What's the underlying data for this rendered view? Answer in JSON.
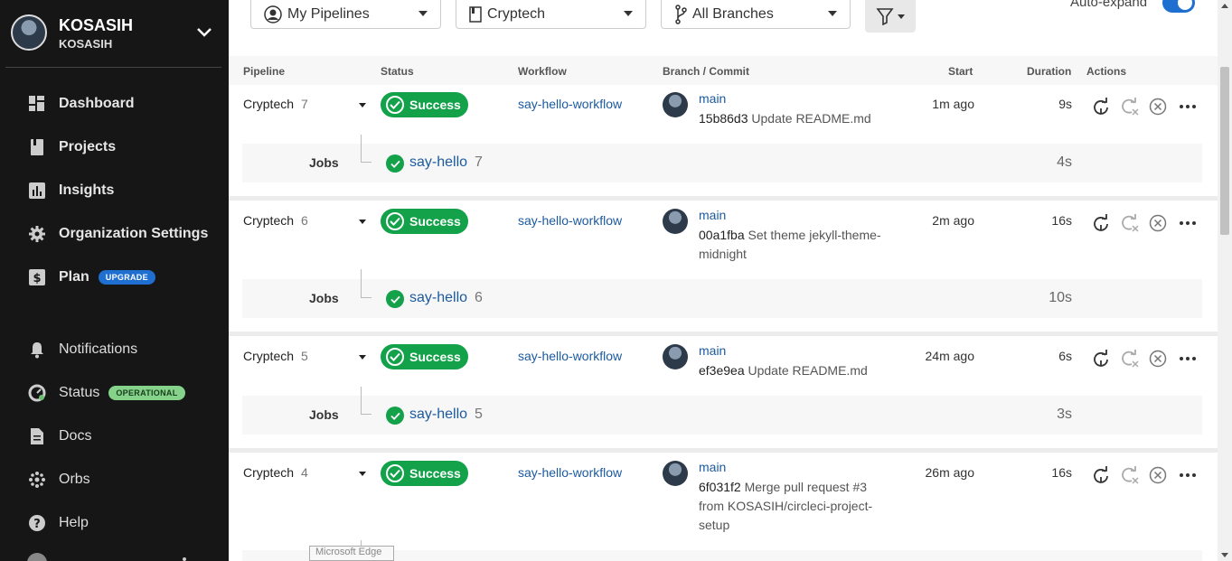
{
  "org": {
    "name": "KOSASIH",
    "sub": "KOSASIH"
  },
  "nav_primary": [
    {
      "label": "Dashboard",
      "icon": "dashboard-icon"
    },
    {
      "label": "Projects",
      "icon": "projects-icon"
    },
    {
      "label": "Insights",
      "icon": "insights-icon"
    },
    {
      "label": "Organization Settings",
      "icon": "gear-icon"
    },
    {
      "label": "Plan",
      "icon": "dollar-icon",
      "badge": "UPGRADE"
    }
  ],
  "nav_secondary": [
    {
      "label": "Notifications",
      "icon": "bell-icon"
    },
    {
      "label": "Status",
      "icon": "status-icon",
      "badge": "OPERATIONAL"
    },
    {
      "label": "Docs",
      "icon": "docs-icon"
    },
    {
      "label": "Orbs",
      "icon": "orbs-icon"
    },
    {
      "label": "Help",
      "icon": "help-icon"
    }
  ],
  "filters": {
    "pipelines": "My Pipelines",
    "project": "Cryptech",
    "branches": "All Branches"
  },
  "auto_expand": {
    "label": "Auto-expand",
    "enabled": true
  },
  "columns": [
    "Pipeline",
    "Status",
    "Workflow",
    "Branch / Commit",
    "Start",
    "Duration",
    "Actions"
  ],
  "pipelines": [
    {
      "project": "Cryptech",
      "number": "7",
      "status": "Success",
      "workflow": "say-hello-workflow",
      "branch": "main",
      "sha": "15b86d3",
      "message": "Update README.md",
      "start": "1m ago",
      "duration": "9s",
      "jobs_label": "Jobs",
      "job": "say-hello",
      "job_number": "7",
      "job_duration": "4s"
    },
    {
      "project": "Cryptech",
      "number": "6",
      "status": "Success",
      "workflow": "say-hello-workflow",
      "branch": "main",
      "sha": "00a1fba",
      "message": "Set theme jekyll-theme-midnight",
      "start": "2m ago",
      "duration": "16s",
      "jobs_label": "Jobs",
      "job": "say-hello",
      "job_number": "6",
      "job_duration": "10s"
    },
    {
      "project": "Cryptech",
      "number": "5",
      "status": "Success",
      "workflow": "say-hello-workflow",
      "branch": "main",
      "sha": "ef3e9ea",
      "message": "Update README.md",
      "start": "24m ago",
      "duration": "6s",
      "jobs_label": "Jobs",
      "job": "say-hello",
      "job_number": "5",
      "job_duration": "3s"
    },
    {
      "project": "Cryptech",
      "number": "4",
      "status": "Success",
      "workflow": "say-hello-workflow",
      "branch": "main",
      "sha": "6f031f2",
      "message": "Merge pull request #3 from KOSASIH/circleci-project-setup",
      "start": "26m ago",
      "duration": "16s"
    }
  ],
  "tooltip": "Microsoft Edge",
  "colors": {
    "sidebar": "#161616",
    "success": "#13a24a",
    "link": "#1b5a9e",
    "accent": "#1f6fd0"
  }
}
